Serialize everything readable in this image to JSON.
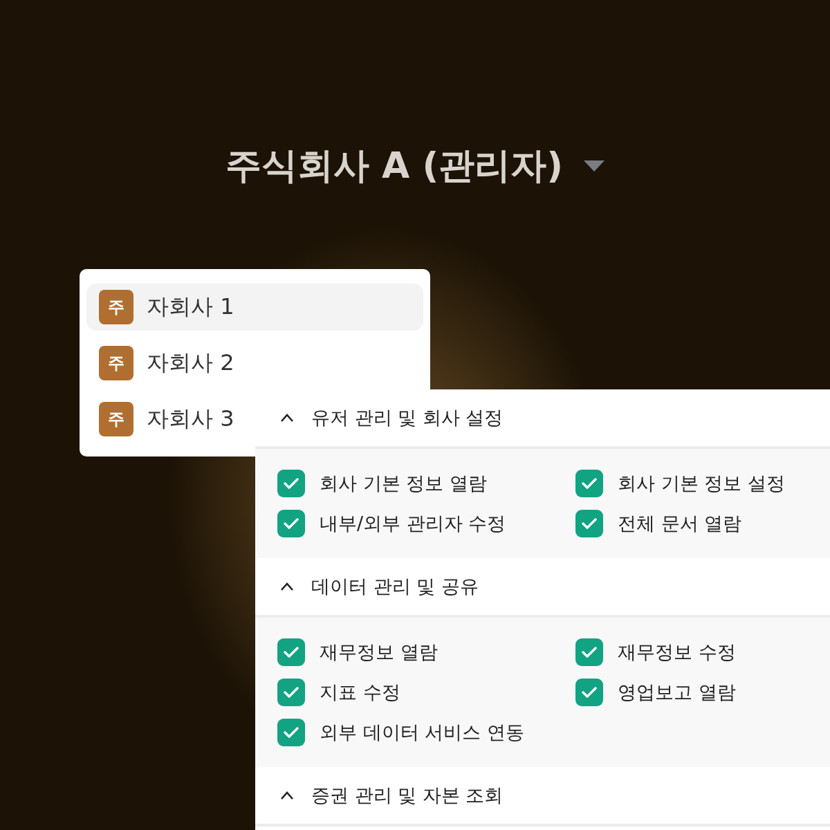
{
  "title": {
    "text": "주식회사 A (관리자)"
  },
  "companies": [
    {
      "badge": "주",
      "name": "자회사 1",
      "selected": true
    },
    {
      "badge": "주",
      "name": "자회사 2",
      "selected": false
    },
    {
      "badge": "주",
      "name": "자회사 3",
      "selected": false
    }
  ],
  "sections": [
    {
      "title": "유저 관리 및 회사 설정",
      "expanded": true,
      "permissions": [
        {
          "label": "회사 기본 정보 열람",
          "checked": true
        },
        {
          "label": "회사 기본 정보 설정",
          "checked": true
        },
        {
          "label": "내부/외부 관리자 수정",
          "checked": true
        },
        {
          "label": "전체 문서 열람",
          "checked": true
        }
      ]
    },
    {
      "title": "데이터 관리 및 공유",
      "expanded": true,
      "permissions": [
        {
          "label": "재무정보 열람",
          "checked": true
        },
        {
          "label": "재무정보 수정",
          "checked": true
        },
        {
          "label": "지표 수정",
          "checked": true
        },
        {
          "label": "영업보고 열람",
          "checked": true
        },
        {
          "label": "외부 데이터 서비스 연동",
          "checked": true
        }
      ]
    },
    {
      "title": "증권 관리 및 자본 조회",
      "expanded": true
    }
  ]
}
